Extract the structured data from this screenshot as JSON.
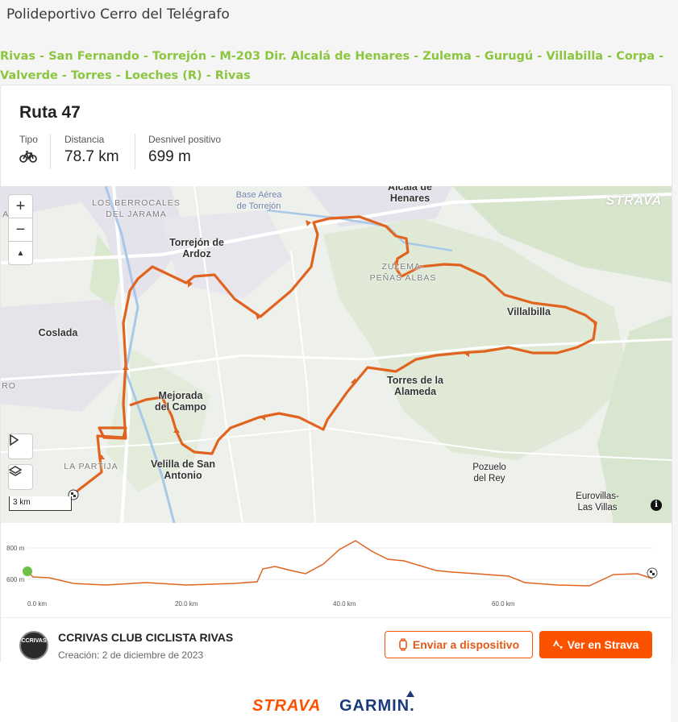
{
  "page": {
    "title": "Polideportivo Cerro del Telégrafo",
    "route_description": "Rivas - San Fernando - Torrejón - M-203 Dir. Alcalá de Henares - Zulema - Gurugú - Villabilla - Corpa - Valverde - Torres - Loeches (R) - Rivas"
  },
  "route": {
    "name": "Ruta 47",
    "stats": {
      "type_label": "Tipo",
      "type_icon": "bike-icon",
      "distance_label": "Distancia",
      "distance_value": "78.7 km",
      "elevation_label": "Desnivel positivo",
      "elevation_value": "699 m"
    }
  },
  "map": {
    "zoom_in": "+",
    "zoom_out": "−",
    "compass": "▲",
    "watermark": "STRAVA",
    "scale_label": "3 km",
    "info": "i",
    "route_color": "#e06420",
    "places": {
      "berrocales": "LOS BERROCALES DEL JARAMA",
      "base": "Base Aérea de Torrejón",
      "alcala": "Alcalá de Henares",
      "torrejon": "Torrejón de Ardoz",
      "zulema": "ZULEMA- PEÑAS ALBAS",
      "villalbilla": "Villalbilla",
      "coslada": "Coslada",
      "torres": "Torres de la Alameda",
      "mejorada": "Mejorada del Campo",
      "velilla": "Velilla de San Antonio",
      "partija": "LA PARTIJA",
      "pozuelo": "Pozuelo del Rey",
      "eurovillas": "Eurovillas- Las Villas",
      "aro": "RO",
      "arp": "AF"
    }
  },
  "elevation_profile": {
    "y_labels": [
      "800 m",
      "600 m"
    ],
    "x_labels": [
      "0.0 km",
      "20.0 km",
      "40.0 km",
      "60.0 km"
    ],
    "line_color": "#e06420"
  },
  "club": {
    "logo_text": "CCRIVAS",
    "name": "CCRIVAS CLUB CICLISTA RIVAS",
    "created": "Creación: 2 de diciembre de 2023"
  },
  "actions": {
    "send_label": "Enviar a dispositivo",
    "strava_label": "Ver en Strava"
  },
  "footer": {
    "strava": "STRAVA",
    "garmin": "GARMIN."
  }
}
